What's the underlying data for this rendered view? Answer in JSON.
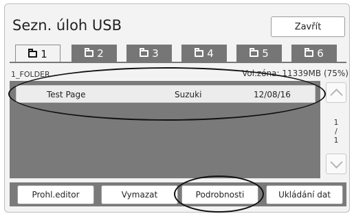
{
  "header": {
    "title": "Sezn. úloh USB",
    "close_label": "Zavřít"
  },
  "tabs": [
    {
      "label": "1",
      "icon": "folder-icon",
      "active": true
    },
    {
      "label": "2",
      "icon": "folder-icon",
      "active": false
    },
    {
      "label": "3",
      "icon": "folder-icon",
      "active": false
    },
    {
      "label": "4",
      "icon": "folder-icon",
      "active": false
    },
    {
      "label": "5",
      "icon": "folder-icon",
      "active": false
    },
    {
      "label": "6",
      "icon": "folder-icon",
      "active": false
    }
  ],
  "folder": {
    "name": "1_FOLDER",
    "volume_info": "Vol.zóna: 11339MB (75%)"
  },
  "jobs": [
    {
      "name": "Test Page",
      "owner": "Suzuki",
      "date": "12/08/16"
    }
  ],
  "pagination": {
    "current": "1",
    "separator": "/",
    "total": "1"
  },
  "actions": {
    "editor_label": "Prohl.editor",
    "delete_label": "Vymazat",
    "details_label": "Podrobnosti",
    "save_label": "Ukládání dat"
  }
}
